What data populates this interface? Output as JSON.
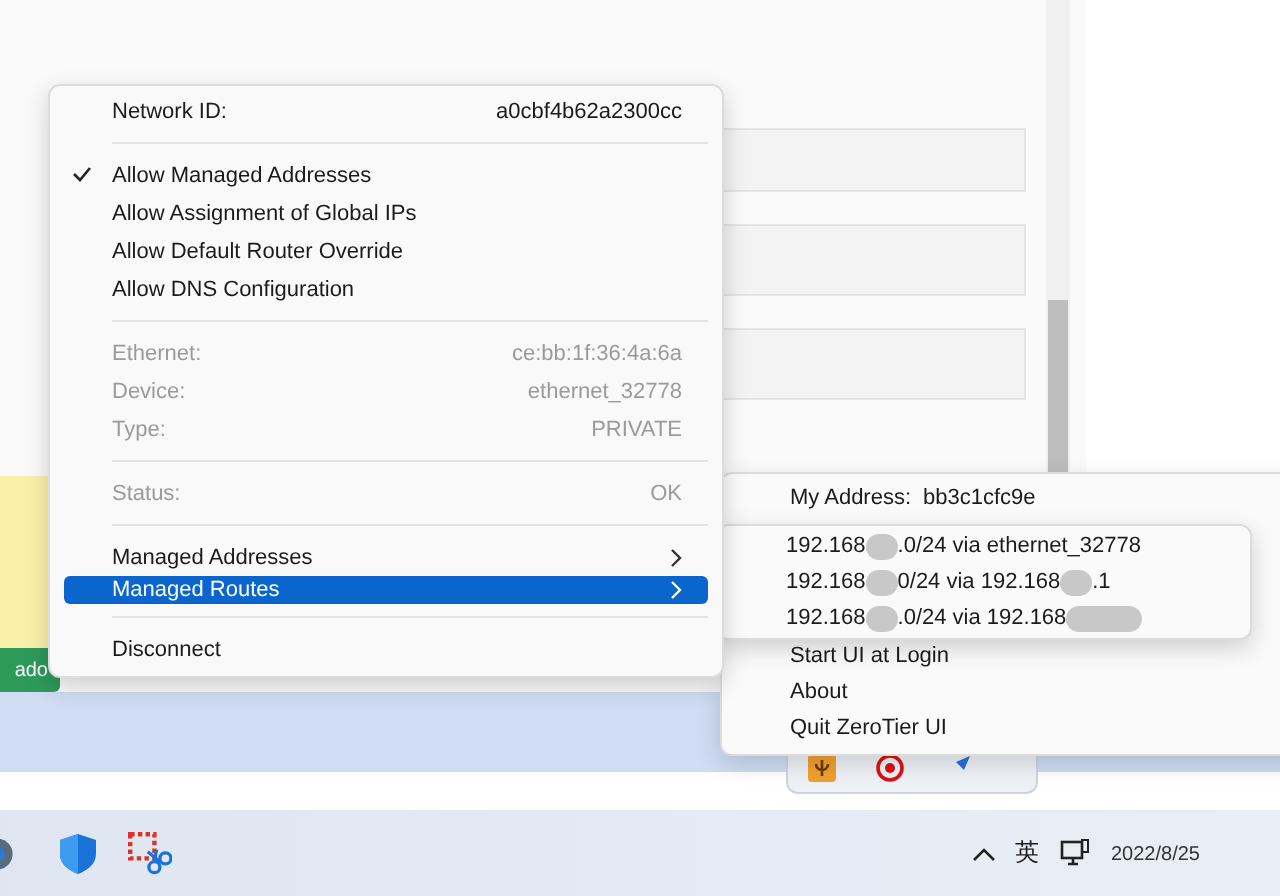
{
  "background": {
    "button": "ado"
  },
  "network_menu": {
    "items": [
      {
        "kind": "pair",
        "label": "Network ID:",
        "value": "a0cbf4b62a2300cc",
        "disabled": false
      },
      {
        "kind": "separator"
      },
      {
        "kind": "check",
        "label": "Allow Managed Addresses",
        "checked": true
      },
      {
        "kind": "check",
        "label": "Allow Assignment of Global IPs",
        "checked": false
      },
      {
        "kind": "check",
        "label": "Allow Default Router Override",
        "checked": false
      },
      {
        "kind": "check",
        "label": "Allow DNS Configuration",
        "checked": false
      },
      {
        "kind": "separator"
      },
      {
        "kind": "pair",
        "label": "Ethernet:",
        "value": "ce:bb:1f:36:4a:6a",
        "disabled": true
      },
      {
        "kind": "pair",
        "label": "Device:",
        "value": "ethernet_32778",
        "disabled": true
      },
      {
        "kind": "pair",
        "label": "Type:",
        "value": "PRIVATE",
        "disabled": true
      },
      {
        "kind": "separator"
      },
      {
        "kind": "pair",
        "label": "Status:",
        "value": "OK",
        "disabled": true
      },
      {
        "kind": "separator"
      },
      {
        "kind": "submenu",
        "label": "Managed Addresses",
        "selected": false
      },
      {
        "kind": "submenu",
        "label": "Managed Routes",
        "selected": true
      },
      {
        "kind": "separator"
      },
      {
        "kind": "action",
        "label": "Disconnect"
      }
    ]
  },
  "routes_submenu": {
    "routes": [
      {
        "parts": [
          "192.168",
          ".0/24 via ethernet_32778"
        ],
        "trailing_redaction": false
      },
      {
        "parts": [
          "192.168",
          "0/24 via 192.168",
          ".1"
        ],
        "trailing_redaction": false
      },
      {
        "parts": [
          "192.168",
          ".0/24 via 192.168"
        ],
        "trailing_redaction": true
      }
    ]
  },
  "tray_menu": {
    "address_label": "My Address:",
    "address": "bb3c1cfc9e",
    "items": [
      "Start UI at Login",
      "About",
      "Quit ZeroTier UI"
    ]
  },
  "taskbar": {
    "ime": "英",
    "date": "2022/8/25"
  }
}
